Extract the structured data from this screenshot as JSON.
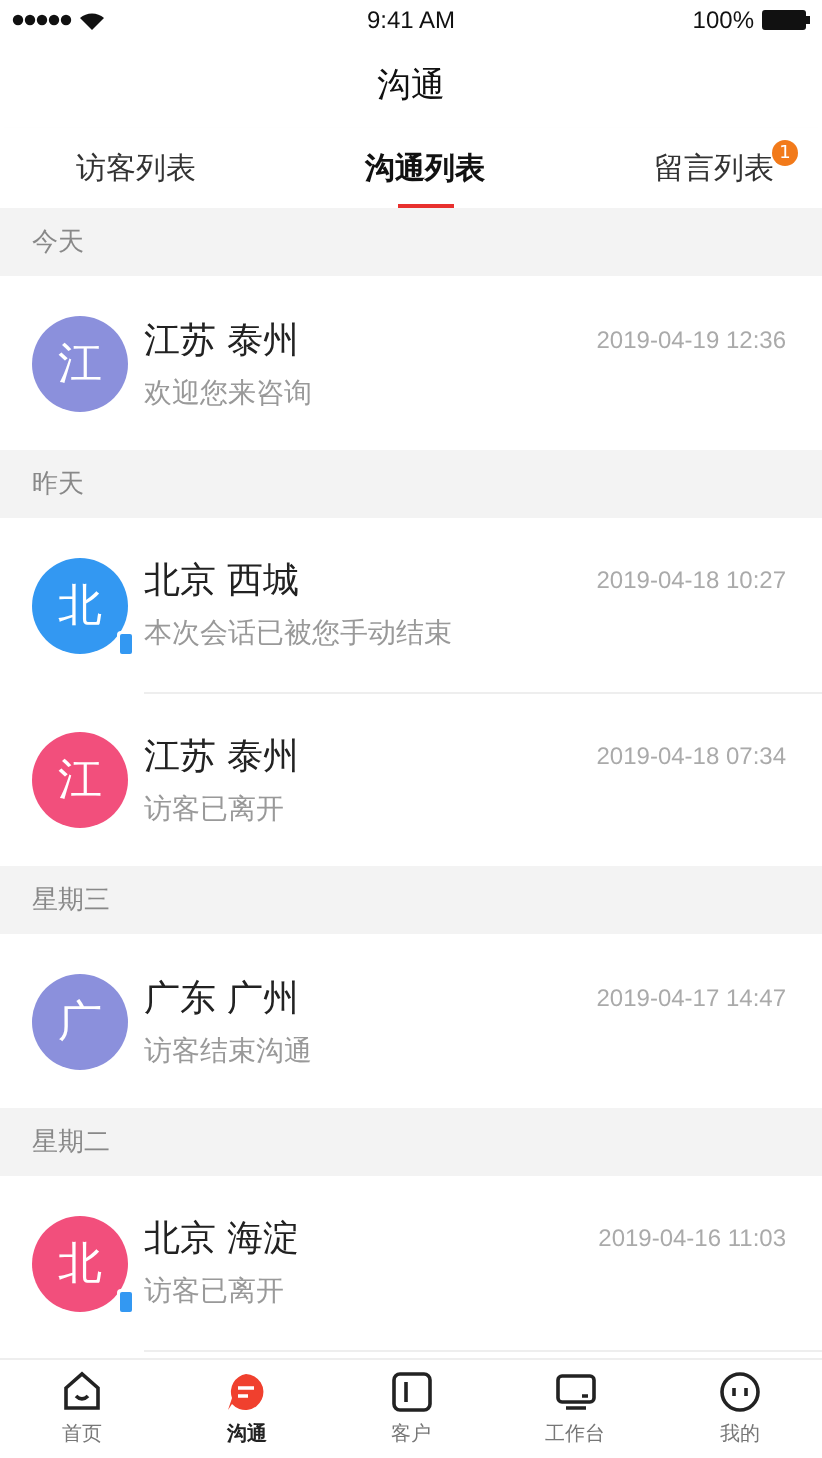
{
  "status_bar": {
    "time": "9:41 AM",
    "battery": "100%"
  },
  "title": "沟通",
  "tabs": [
    {
      "label": "访客列表",
      "selected": false
    },
    {
      "label": "沟通列表",
      "selected": true
    },
    {
      "label": "留言列表",
      "selected": false,
      "badge": "1"
    }
  ],
  "sections": [
    {
      "header": "今天",
      "items": [
        {
          "avatar": "江",
          "color": "#8b90dc",
          "name": "江苏 泰州",
          "time": "2019-04-19 12:36",
          "message": "欢迎您来咨询",
          "mobile": false
        }
      ]
    },
    {
      "header": "昨天",
      "items": [
        {
          "avatar": "北",
          "color": "#3398f2",
          "name": "北京 西城",
          "time": "2019-04-18 10:27",
          "message": "本次会话已被您手动结束",
          "mobile": true
        },
        {
          "avatar": "江",
          "color": "#f24f7c",
          "name": "江苏 泰州",
          "time": "2019-04-18 07:34",
          "message": "访客已离开",
          "mobile": false
        }
      ]
    },
    {
      "header": "星期三",
      "items": [
        {
          "avatar": "广",
          "color": "#8b90dc",
          "name": "广东 广州",
          "time": "2019-04-17 14:47",
          "message": "访客结束沟通",
          "mobile": false
        }
      ]
    },
    {
      "header": "星期二",
      "items": [
        {
          "avatar": "北",
          "color": "#f24f7c",
          "name": "北京 海淀",
          "time": "2019-04-16 11:03",
          "message": "访客已离开",
          "mobile": true
        }
      ]
    }
  ],
  "bottom_tabs": [
    {
      "kind": "home",
      "label": "首页",
      "selected": false
    },
    {
      "kind": "chat",
      "label": "沟通",
      "selected": true
    },
    {
      "kind": "customer",
      "label": "客户",
      "selected": false
    },
    {
      "kind": "desk",
      "label": "工作台",
      "selected": false
    },
    {
      "kind": "me",
      "label": "我的",
      "selected": false
    }
  ]
}
